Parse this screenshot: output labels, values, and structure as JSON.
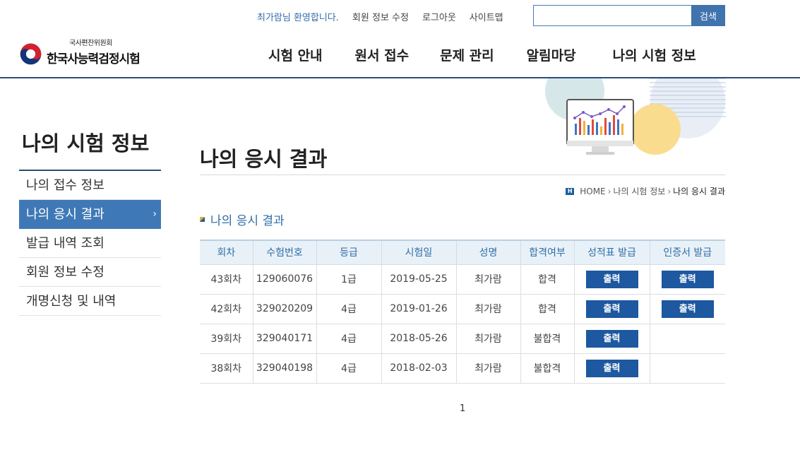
{
  "header": {
    "welcome": "최가람님 환영합니다.",
    "links": [
      "회원 정보 수정",
      "로그아웃",
      "사이트맵"
    ],
    "search": {
      "value": "",
      "placeholder": "",
      "button_label": "검색"
    },
    "logo": {
      "sub": "국사편찬위원회",
      "main": "한국사능력검정시험"
    },
    "nav": [
      "시험 안내",
      "원서 접수",
      "문제 관리",
      "알림마당",
      "나의 시험 정보"
    ]
  },
  "sidebar": {
    "title": "나의 시험 정보",
    "items": [
      {
        "label": "나의 접수 정보"
      },
      {
        "label": "나의 응시 결과",
        "chevron": "›"
      },
      {
        "label": "발급 내역 조회"
      },
      {
        "label": "회원 정보 수정"
      },
      {
        "label": "개명신청 및 내역"
      }
    ]
  },
  "content": {
    "page_title": "나의 응시 결과",
    "breadcrumb": {
      "home": "HOME",
      "home_icon_text": "H",
      "sep": "›",
      "level1": "나의 시험 정보",
      "current": "나의 응시 결과"
    },
    "section_title": "나의 응시 결과",
    "table": {
      "headers": [
        "회차",
        "수험번호",
        "등급",
        "시험일",
        "성명",
        "합격여부",
        "성적표 발급",
        "인증서 발급"
      ],
      "print_label": "출력",
      "rows": [
        {
          "round": "43회차",
          "number": "129060076",
          "grade": "1급",
          "date": "2019-05-25",
          "name": "최가람",
          "result": "합격",
          "report": true,
          "cert": true
        },
        {
          "round": "42회차",
          "number": "329020209",
          "grade": "4급",
          "date": "2019-01-26",
          "name": "최가람",
          "result": "합격",
          "report": true,
          "cert": true
        },
        {
          "round": "39회차",
          "number": "329040171",
          "grade": "4급",
          "date": "2018-05-26",
          "name": "최가람",
          "result": "불합격",
          "report": true,
          "cert": false
        },
        {
          "round": "38회차",
          "number": "329040198",
          "grade": "4급",
          "date": "2018-02-03",
          "name": "최가람",
          "result": "불합격",
          "report": true,
          "cert": false
        }
      ]
    },
    "pagination": {
      "current": "1"
    }
  },
  "colors": {
    "brand": "#2a4d7a",
    "accent": "#3f78b6",
    "button": "#1d58a0",
    "link": "#2f6ea7"
  },
  "icons": {
    "logo": "taegeuk-logo-icon",
    "home": "home-icon",
    "bullet": "section-bullet-icon",
    "chevron": "chevron-right-icon"
  }
}
